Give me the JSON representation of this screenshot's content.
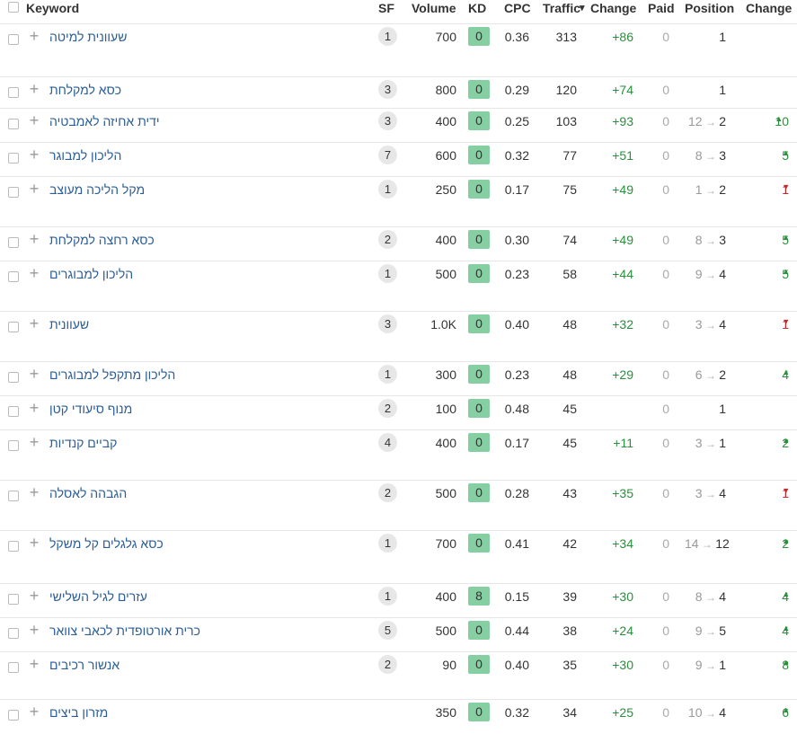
{
  "columns": {
    "keyword": "Keyword",
    "sf": "SF",
    "volume": "Volume",
    "kd": "KD",
    "cpc": "CPC",
    "traffic": "Traffic",
    "traffic_sort_icon": "▾",
    "change": "Change",
    "paid": "Paid",
    "position": "Position",
    "position_change": "Change"
  },
  "colors": {
    "kd_badge": "#86cfa3",
    "up": "#2a8f3c",
    "down": "#c0282c",
    "keyword_link": "#2b5d97"
  },
  "rows": [
    {
      "keyword": "שעוונית למיטה",
      "sf": "1",
      "volume": "700",
      "kd": "0",
      "cpc": "0.36",
      "traffic": "313",
      "change": "+86",
      "paid": "0",
      "prev": "",
      "pos": "1",
      "pchg": "",
      "dir": ""
    },
    {
      "keyword": "כסא למקלחת",
      "sf": "3",
      "volume": "800",
      "kd": "0",
      "cpc": "0.29",
      "traffic": "120",
      "change": "+74",
      "paid": "0",
      "prev": "",
      "pos": "1",
      "pchg": "",
      "dir": ""
    },
    {
      "keyword": "ידית אחיזה לאמבטיה",
      "sf": "3",
      "volume": "400",
      "kd": "0",
      "cpc": "0.25",
      "traffic": "103",
      "change": "+93",
      "paid": "0",
      "prev": "12",
      "pos": "2",
      "pchg": "10",
      "dir": "up"
    },
    {
      "keyword": "הליכון למבוגר",
      "sf": "7",
      "volume": "600",
      "kd": "0",
      "cpc": "0.32",
      "traffic": "77",
      "change": "+51",
      "paid": "0",
      "prev": "8",
      "pos": "3",
      "pchg": "5",
      "dir": "up"
    },
    {
      "keyword": "מקל הליכה מעוצב",
      "sf": "1",
      "volume": "250",
      "kd": "0",
      "cpc": "0.17",
      "traffic": "75",
      "change": "+49",
      "paid": "0",
      "prev": "1",
      "pos": "2",
      "pchg": "1",
      "dir": "down"
    },
    {
      "keyword": "כסא רחצה למקלחת",
      "sf": "2",
      "volume": "400",
      "kd": "0",
      "cpc": "0.30",
      "traffic": "74",
      "change": "+49",
      "paid": "0",
      "prev": "8",
      "pos": "3",
      "pchg": "5",
      "dir": "up"
    },
    {
      "keyword": "הליכון למבוגרים",
      "sf": "1",
      "volume": "500",
      "kd": "0",
      "cpc": "0.23",
      "traffic": "58",
      "change": "+44",
      "paid": "0",
      "prev": "9",
      "pos": "4",
      "pchg": "5",
      "dir": "up"
    },
    {
      "keyword": "שעוונית",
      "sf": "3",
      "volume": "1.0K",
      "kd": "0",
      "cpc": "0.40",
      "traffic": "48",
      "change": "+32",
      "paid": "0",
      "prev": "3",
      "pos": "4",
      "pchg": "1",
      "dir": "down"
    },
    {
      "keyword": "הליכון מתקפל למבוגרים",
      "sf": "1",
      "volume": "300",
      "kd": "0",
      "cpc": "0.23",
      "traffic": "48",
      "change": "+29",
      "paid": "0",
      "prev": "6",
      "pos": "2",
      "pchg": "4",
      "dir": "up"
    },
    {
      "keyword": "מנוף סיעודי קטן",
      "sf": "2",
      "volume": "100",
      "kd": "0",
      "cpc": "0.48",
      "traffic": "45",
      "change": "",
      "paid": "0",
      "prev": "",
      "pos": "1",
      "pchg": "",
      "dir": ""
    },
    {
      "keyword": "קביים קנדיות",
      "sf": "4",
      "volume": "400",
      "kd": "0",
      "cpc": "0.17",
      "traffic": "45",
      "change": "+11",
      "paid": "0",
      "prev": "3",
      "pos": "1",
      "pchg": "2",
      "dir": "up"
    },
    {
      "keyword": "הגבהה לאסלה",
      "sf": "2",
      "volume": "500",
      "kd": "0",
      "cpc": "0.28",
      "traffic": "43",
      "change": "+35",
      "paid": "0",
      "prev": "3",
      "pos": "4",
      "pchg": "1",
      "dir": "down"
    },
    {
      "keyword": "כסא גלגלים קל משקל",
      "sf": "1",
      "volume": "700",
      "kd": "0",
      "cpc": "0.41",
      "traffic": "42",
      "change": "+34",
      "paid": "0",
      "prev": "14",
      "pos": "12",
      "pchg": "2",
      "dir": "up"
    },
    {
      "keyword": "עזרים לגיל השלישי",
      "sf": "1",
      "volume": "400",
      "kd": "8",
      "cpc": "0.15",
      "traffic": "39",
      "change": "+30",
      "paid": "0",
      "prev": "8",
      "pos": "4",
      "pchg": "4",
      "dir": "up"
    },
    {
      "keyword": "כרית אורטופדית לכאבי צוואר",
      "sf": "5",
      "volume": "500",
      "kd": "0",
      "cpc": "0.44",
      "traffic": "38",
      "change": "+24",
      "paid": "0",
      "prev": "9",
      "pos": "5",
      "pchg": "4",
      "dir": "up"
    },
    {
      "keyword": "אנשור רכיבים",
      "sf": "2",
      "volume": "90",
      "kd": "0",
      "cpc": "0.40",
      "traffic": "35",
      "change": "+30",
      "paid": "0",
      "prev": "9",
      "pos": "1",
      "pchg": "8",
      "dir": "up"
    },
    {
      "keyword": "מזרון ביצים",
      "sf": "",
      "volume": "350",
      "kd": "0",
      "cpc": "0.32",
      "traffic": "34",
      "change": "+25",
      "paid": "0",
      "prev": "10",
      "pos": "4",
      "pchg": "6",
      "dir": "up"
    }
  ]
}
